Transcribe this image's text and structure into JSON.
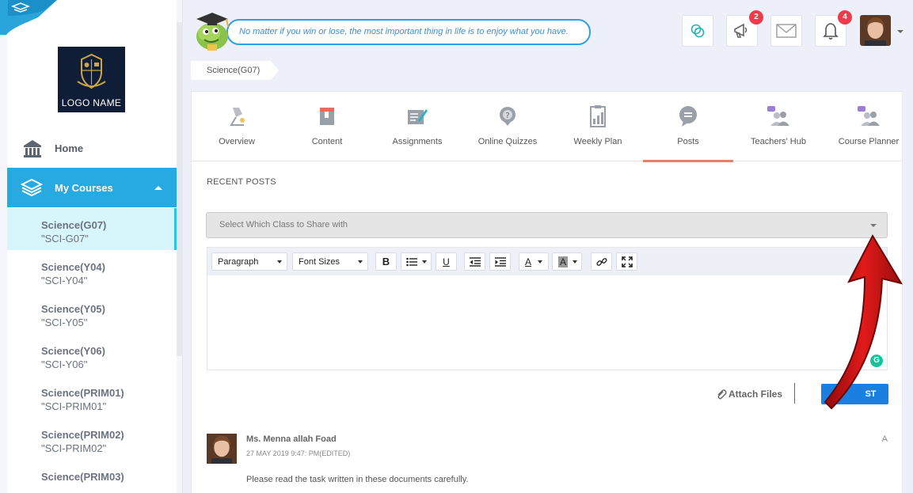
{
  "header": {
    "quote": "No matter if you win or lose, the most important thing in life is to enjoy what you have.",
    "announcements_count": "2",
    "notifications_count": "4"
  },
  "sidebar": {
    "logo_text": "LOGO NAME",
    "home_label": "Home",
    "my_courses_label": "My Courses",
    "courses": [
      {
        "name": "Science(G07)",
        "code": "\"SCI-G07\""
      },
      {
        "name": "Science(Y04)",
        "code": "\"SCI-Y04\""
      },
      {
        "name": "Science(Y05)",
        "code": "\"SCI-Y05\""
      },
      {
        "name": "Science(Y06)",
        "code": "\"SCI-Y06\""
      },
      {
        "name": "Science(PRIM01)",
        "code": "\"SCI-PRIM01\""
      },
      {
        "name": "Science(PRIM02)",
        "code": "\"SCI-PRIM02\""
      },
      {
        "name": "Science(PRIM03)",
        "code": ""
      }
    ]
  },
  "breadcrumb": "Science(G07)",
  "tabs": [
    {
      "label": "Overview",
      "icon": "overview-icon"
    },
    {
      "label": "Content",
      "icon": "content-icon"
    },
    {
      "label": "Assignments",
      "icon": "assignments-icon"
    },
    {
      "label": "Online Quizzes",
      "icon": "online-quizzes-icon"
    },
    {
      "label": "Weekly Plan",
      "icon": "weekly-plan-icon"
    },
    {
      "label": "Posts",
      "icon": "posts-icon"
    },
    {
      "label": "Teachers' Hub",
      "icon": "teachers-hub-icon"
    },
    {
      "label": "Course Planner",
      "icon": "course-planner-icon"
    }
  ],
  "posts": {
    "section_title": "RECENT POSTS",
    "class_select_placeholder": "Select Which Class to Share with",
    "toolbar": {
      "paragraph": "Paragraph",
      "font_sizes": "Font Sizes",
      "bold": "B",
      "underline": "U",
      "text_color": "A",
      "highlight": "A"
    },
    "attach_label": "Attach Files",
    "post_button": "ST",
    "recent": {
      "author": "Ms. Menna allah Foad",
      "date": "27 MAY 2019 9:47: PM(EDITED)",
      "body": "Please read the task written in these documents carefully.",
      "menu": "A"
    }
  },
  "colors": {
    "accent": "#27a9e1",
    "active_tab": "#f07e60",
    "badge": "#ee3d4a",
    "post_button": "#1a7fe0",
    "annotation_arrow": "#d11313"
  }
}
